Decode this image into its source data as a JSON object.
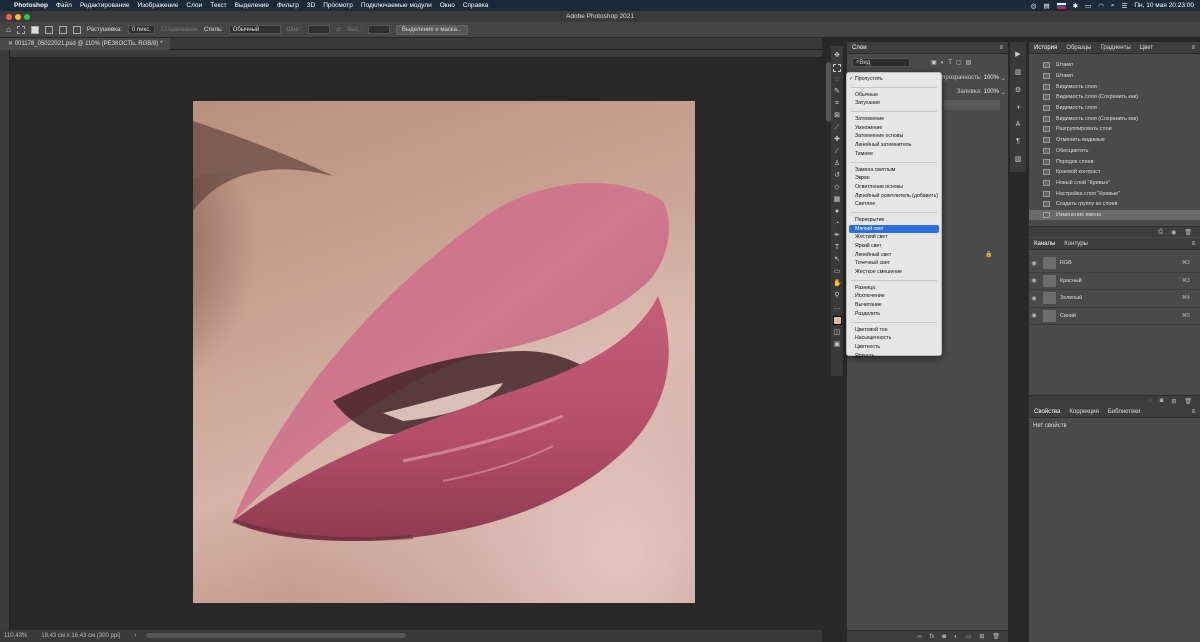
{
  "menubar": {
    "app": "Photoshop",
    "items": [
      "Файл",
      "Редактирование",
      "Изображение",
      "Слои",
      "Текст",
      "Выделение",
      "Фильтр",
      "3D",
      "Просмотр",
      "Подключаемые модули",
      "Окно",
      "Справка"
    ],
    "datetime": "Пн, 10 мая  20:23:00"
  },
  "titlebar": {
    "title": "Adobe Photoshop 2021"
  },
  "options": {
    "feather_label": "Растушевка:",
    "feather_value": "0 пикс.",
    "antialias_label": "Сглаживание",
    "style_label": "Стиль:",
    "style_value": "Обычный",
    "width_label": "Шир.:",
    "height_label": "Выс.:",
    "select_mask_button": "Выделение и маска..."
  },
  "document": {
    "tab_title": "001178_05022021.psd @ 110% (РЕЗКОСТЬ, RGB/8) *",
    "zoom": "110,43%",
    "doc_size": "18,43 см x 16,43 см (300 ppi)"
  },
  "layers_panel": {
    "title": "Слои",
    "kind_filter": "Вид",
    "opacity_label": "Непрозрачность:",
    "opacity_value": "100%",
    "fill_label": "Заливка:",
    "fill_value": "100%"
  },
  "blend_menu": {
    "groups": [
      [
        "Пропустить"
      ],
      [
        "Обычные",
        "Затухание"
      ],
      [
        "Затемнение",
        "Умножение",
        "Затемнение основы",
        "Линейный затемнитель",
        "Темнее"
      ],
      [
        "Замена светлым",
        "Экран",
        "Осветление основы",
        "Линейный осветлитель (добавить)",
        "Светлее"
      ],
      [
        "Перекрытие",
        "Мягкий свет",
        "Жесткий свет",
        "Яркий свет",
        "Линейный свет",
        "Точечный свет",
        "Жесткое смешение"
      ],
      [
        "Разница",
        "Исключение",
        "Вычитание",
        "Разделить"
      ],
      [
        "Цветовой тон",
        "Насыщенность",
        "Цветность",
        "Яркость"
      ]
    ],
    "checked": "Пропустить",
    "selected": "Мягкий свет"
  },
  "history_panel": {
    "tabs": [
      "История",
      "Образцы",
      "Градиенты",
      "Цвет"
    ],
    "items": [
      "Штамп",
      "Штамп",
      "Видимость слоя",
      "Видимость слоя (Сохранить как)",
      "Видимость слоя",
      "Видимость слоя (Сохранить как)",
      "Разгруппировать слои",
      "Отменить видимые",
      "Обесцветить",
      "Порядок слоев",
      "Краевой контраст",
      "Новый слой \"Кривые\"",
      "Настройка слоя \"Кривые\"",
      "Создать группу из слоев",
      "Изменение имени"
    ],
    "active_index": 14
  },
  "channels_panel": {
    "tabs": [
      "Каналы",
      "Контуры"
    ],
    "channels": [
      {
        "name": "RGB",
        "shortcut": "⌘2"
      },
      {
        "name": "Красный",
        "shortcut": "⌘3"
      },
      {
        "name": "Зеленый",
        "shortcut": "⌘4"
      },
      {
        "name": "Синий",
        "shortcut": "⌘5"
      }
    ]
  },
  "properties_panel": {
    "tabs": [
      "Свойства",
      "Коррекция",
      "Библиотеки"
    ],
    "empty_text": "Нет свойств"
  }
}
